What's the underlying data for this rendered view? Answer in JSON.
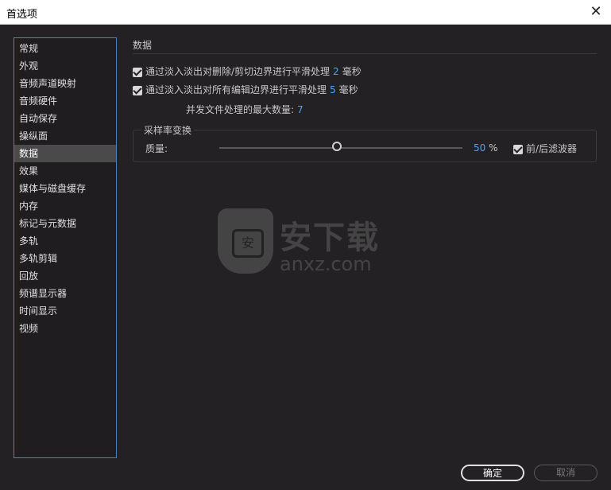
{
  "window": {
    "title": "首选项",
    "close_glyph": "✕"
  },
  "sidebar": {
    "items": [
      "常规",
      "外观",
      "音频声道映射",
      "音频硬件",
      "自动保存",
      "操纵面",
      "数据",
      "效果",
      "媒体与磁盘缓存",
      "内存",
      "标记与元数据",
      "多轨",
      "多轨剪辑",
      "回放",
      "频谱显示器",
      "时间显示",
      "视频"
    ],
    "active_index": 6
  },
  "section": {
    "title": "数据"
  },
  "options": {
    "opt1": {
      "label": "通过淡入淡出对删除/剪切边界进行平滑处理",
      "value": "2",
      "unit": "毫秒",
      "checked": true
    },
    "opt2": {
      "label": "通过淡入淡出对所有编辑边界进行平滑处理",
      "value": "5",
      "unit": "毫秒",
      "checked": true
    },
    "max_files": {
      "label": "并发文件处理的最大数量:",
      "value": "7"
    }
  },
  "sample_rate": {
    "group_label": "采样率变换",
    "quality_label": "质量:",
    "quality_value": "50",
    "quality_unit": "%",
    "quality_level_percent": 50,
    "filter_label": "前/后滤波器",
    "filter_checked": true
  },
  "watermark": {
    "brand": "安下载",
    "url": "anxz.com",
    "shield_char": "安"
  },
  "buttons": {
    "ok": "确定",
    "cancel": "取消"
  },
  "colors": {
    "accent": "#4aa3ff",
    "sidebar_border": "#4a7fc8",
    "background": "#232123"
  }
}
